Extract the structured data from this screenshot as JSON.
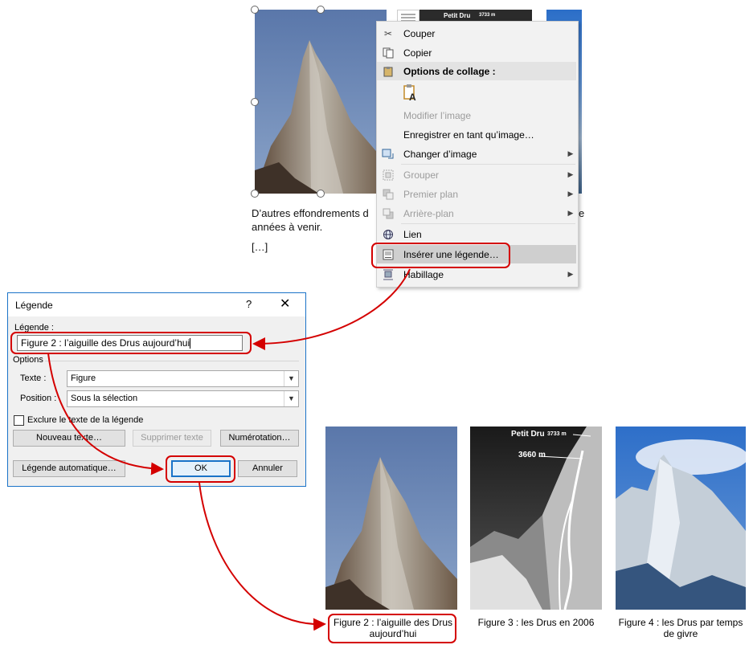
{
  "document": {
    "paragraph_line1_left": "D’autres effondrements d",
    "paragraph_line1_right": "e",
    "paragraph_line2": "années à venir.",
    "ellipsis": "[…]"
  },
  "thumbnail_labels": {
    "petit_dru": "Petit Dru",
    "petit_dru_alt": "3733 m"
  },
  "context_menu": {
    "cut": "Couper",
    "copy": "Copier",
    "paste_options": "Options de collage :",
    "edit_image": "Modifier l’image",
    "save_as_image": "Enregistrer en tant qu’image…",
    "change_image": "Changer d’image",
    "group": "Grouper",
    "bring_forward": "Premier plan",
    "send_backward": "Arrière-plan",
    "link": "Lien",
    "insert_caption": "Insérer une légende…",
    "wrap_text": "Habillage"
  },
  "dialog": {
    "title": "Légende",
    "help": "?",
    "close": "✕",
    "caption_label": "Légende :",
    "caption_value": "Figure 2 : l’aiguille des Drus aujourd’hui",
    "options_label": "Options",
    "text_label": "Texte :",
    "text_value": "Figure",
    "position_label": "Position :",
    "position_value": "Sous la sélection",
    "exclude_label": "Exclure le texte de la légende",
    "new_label_button": "Nouveau texte…",
    "delete_label_button": "Supprimer texte",
    "numbering_button": "Numérotation…",
    "autocaption_button": "Légende automatique…",
    "ok_button": "OK",
    "cancel_button": "Annuler"
  },
  "figures": {
    "fig2_caption": "Figure 2 : l’aiguille des Drus aujourd’hui",
    "fig3_caption": "Figure 3 : les Drus en 2006",
    "fig4_caption": "Figure 4 : les Drus par temps de givre",
    "fig3_label_top": "Petit Dru",
    "fig3_label_top_alt": "3733 m",
    "fig3_label_mid": "3660 m"
  },
  "colors": {
    "callout": "#d40000",
    "dialog_border": "#1a73c8",
    "menu_highlight": "#d5d5d5"
  }
}
